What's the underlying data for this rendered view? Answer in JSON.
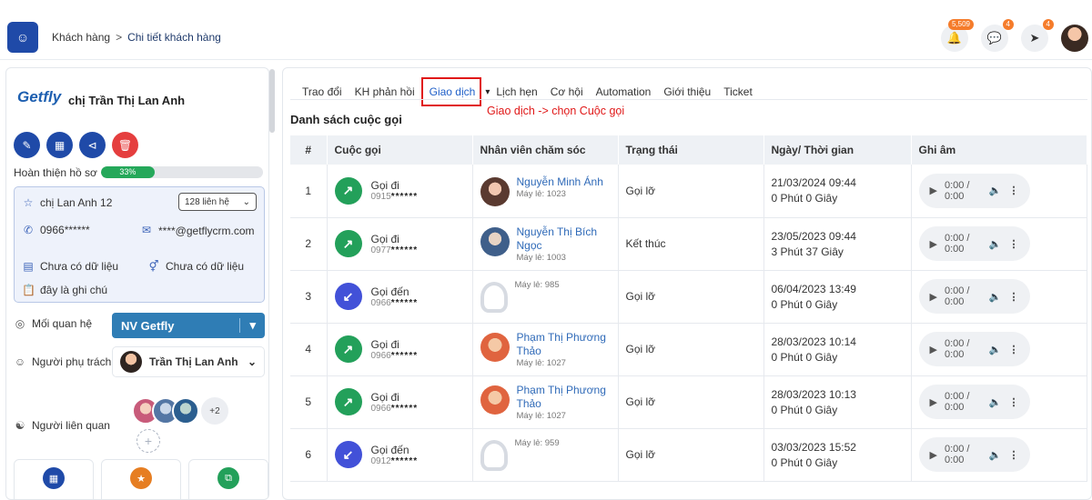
{
  "header": {
    "breadcrumb_root": "Khách hàng",
    "breadcrumb_sep": ">",
    "breadcrumb_current": "Chi tiết khách hàng",
    "bell_count": "5,509",
    "chat_count": "4",
    "rocket_count": "4"
  },
  "customer": {
    "logo_text": "Getfly",
    "name": "chị Trần Thị Lan Anh",
    "progress_label": "Hoàn thiện hồ sơ",
    "progress_value": "33%",
    "progress_fraction": 0.33,
    "contact_name": "chị Lan Anh 12",
    "contacts_count": "128 liên hệ",
    "phone": "0966******",
    "email": "****@getflycrm.com",
    "field1": "Chưa có dữ liệu",
    "field2": "Chưa có dữ liệu",
    "note": "đây là ghi chú",
    "relation_label": "Mối quan hệ",
    "relation_value": "NV Getfly",
    "owner_label": "Người phụ trách",
    "owner_name": "Trần Thị Lan Anh",
    "related_label": "Người liên quan",
    "related_more": "+2"
  },
  "tabs": [
    "Trao đổi",
    "KH phản hồi",
    "Giao dịch",
    "Lịch hẹn",
    "Cơ hội",
    "Automation",
    "Giới thiệu",
    "Ticket"
  ],
  "active_tab_index": 2,
  "annotation": "Giao dịch -> chọn Cuộc gọi",
  "list_title": "Danh sách cuộc gọi",
  "columns": [
    "#",
    "Cuộc gọi",
    "Nhân viên chăm sóc",
    "Trạng thái",
    "Ngày/ Thời gian",
    "Ghi âm"
  ],
  "calls": [
    {
      "no": "1",
      "dir": "Gọi đi",
      "type": "out",
      "phone_prefix": "0915",
      "phone_mask": "******",
      "staff": "Nguyễn Minh Ánh",
      "ext": "Máy lẻ: 1023",
      "status": "Gọi lỡ",
      "date": "21/03/2024 09:44",
      "duration": "0 Phút 0 Giây",
      "audio": "0:00 / 0:00"
    },
    {
      "no": "2",
      "dir": "Gọi đi",
      "type": "out",
      "phone_prefix": "0977",
      "phone_mask": "******",
      "staff": "Nguyễn Thị Bích Ngọc",
      "ext": "Máy lẻ: 1003",
      "status": "Kết thúc",
      "date": "23/05/2023 09:44",
      "duration": "3 Phút 37 Giây",
      "audio": "0:00 / 0:00"
    },
    {
      "no": "3",
      "dir": "Gọi đến",
      "type": "in",
      "phone_prefix": "0966",
      "phone_mask": "******",
      "staff": "",
      "ext": "Máy lẻ: 985",
      "status": "Gọi lỡ",
      "date": "06/04/2023 13:49",
      "duration": "0 Phút 0 Giây",
      "audio": "0:00 / 0:00"
    },
    {
      "no": "4",
      "dir": "Gọi đi",
      "type": "out",
      "phone_prefix": "0966",
      "phone_mask": "******",
      "staff": "Phạm Thị Phương Thảo",
      "ext": "Máy lẻ: 1027",
      "status": "Gọi lỡ",
      "date": "28/03/2023 10:14",
      "duration": "0 Phút 0 Giây",
      "audio": "0:00 / 0:00"
    },
    {
      "no": "5",
      "dir": "Gọi đi",
      "type": "out",
      "phone_prefix": "0966",
      "phone_mask": "******",
      "staff": "Phạm Thị Phương Thảo",
      "ext": "Máy lẻ: 1027",
      "status": "Gọi lỡ",
      "date": "28/03/2023 10:13",
      "duration": "0 Phút 0 Giây",
      "audio": "0:00 / 0:00"
    },
    {
      "no": "6",
      "dir": "Gọi đến",
      "type": "in",
      "phone_prefix": "0912",
      "phone_mask": "******",
      "staff": "",
      "ext": "Máy lẻ: 959",
      "status": "Gọi lỡ",
      "date": "03/03/2023 15:52",
      "duration": "0 Phút 0 Giây",
      "audio": "0:00 / 0:00"
    }
  ]
}
